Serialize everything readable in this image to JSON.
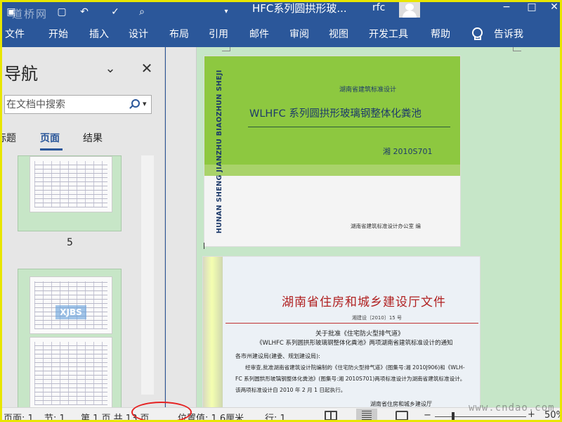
{
  "titlebar": {
    "doc_title": "HFC系列圆拱形玻...",
    "user_name": "rfc",
    "watermark": "道桥网",
    "restore_glyph": "□",
    "close_glyph": "✕"
  },
  "ribbon": {
    "tabs": [
      "文件",
      "开始",
      "插入",
      "设计",
      "布局",
      "引用",
      "邮件",
      "审阅",
      "视图",
      "开发工具",
      "帮助",
      "告诉我"
    ]
  },
  "nav": {
    "title": "导航",
    "search_placeholder": "在文档中搜索",
    "tabs": [
      "标题",
      "页面",
      "结果"
    ],
    "active_tab": "页面",
    "thumb_page_number": "5",
    "thumb_watermark": "XJBS"
  },
  "cover": {
    "vertical_text": "HUNAN SHENG JIANZHU BIAOZHUN SHEJI",
    "org": "湖南省建筑标准设计",
    "title": "WLHFC 系列圆拱形玻璃钢整体化粪池",
    "code": "湘 2010S701",
    "publisher": "湖南省建筑标准设计办公室 编"
  },
  "scan": {
    "heading": "湖南省住房和城乡建设厅文件",
    "doc_no": "湘建设〔2010〕15 号",
    "subject_1": "关于批准《住宅防火型排气道》",
    "subject_2": "《WLHFC 系列圆拱形玻璃钢整体化粪池》两项湖南省建筑标准设计的通知",
    "salutation": "各市州建设局(建委、规划建设局):",
    "body_1": "经审查,批准湖南省建筑设计院编制的《住宅防火型排气道》(图集号:湘 2010J906)和《WLH-",
    "body_2": "FC 系列圆拱形玻璃钢整体化粪池》(图集号:湘 2010S701)两项标准设计为湖南省建筑标准设计。",
    "body_3": "该两项标准设计自 2010 年 2 月 1 日起执行。",
    "signature": "湖南省住房和城乡建设厅"
  },
  "statusbar": {
    "page_label": "页面: 1",
    "section_label": "节: 1",
    "page_of": "第 1 页,共 13 页",
    "position": "位置值: 1.6厘米",
    "line": "行: 1",
    "zoom_minus": "−",
    "zoom_plus": "+",
    "zoom_percent": "50%",
    "zoom_level": 0.2,
    "watermark": "www.cndao.com"
  }
}
